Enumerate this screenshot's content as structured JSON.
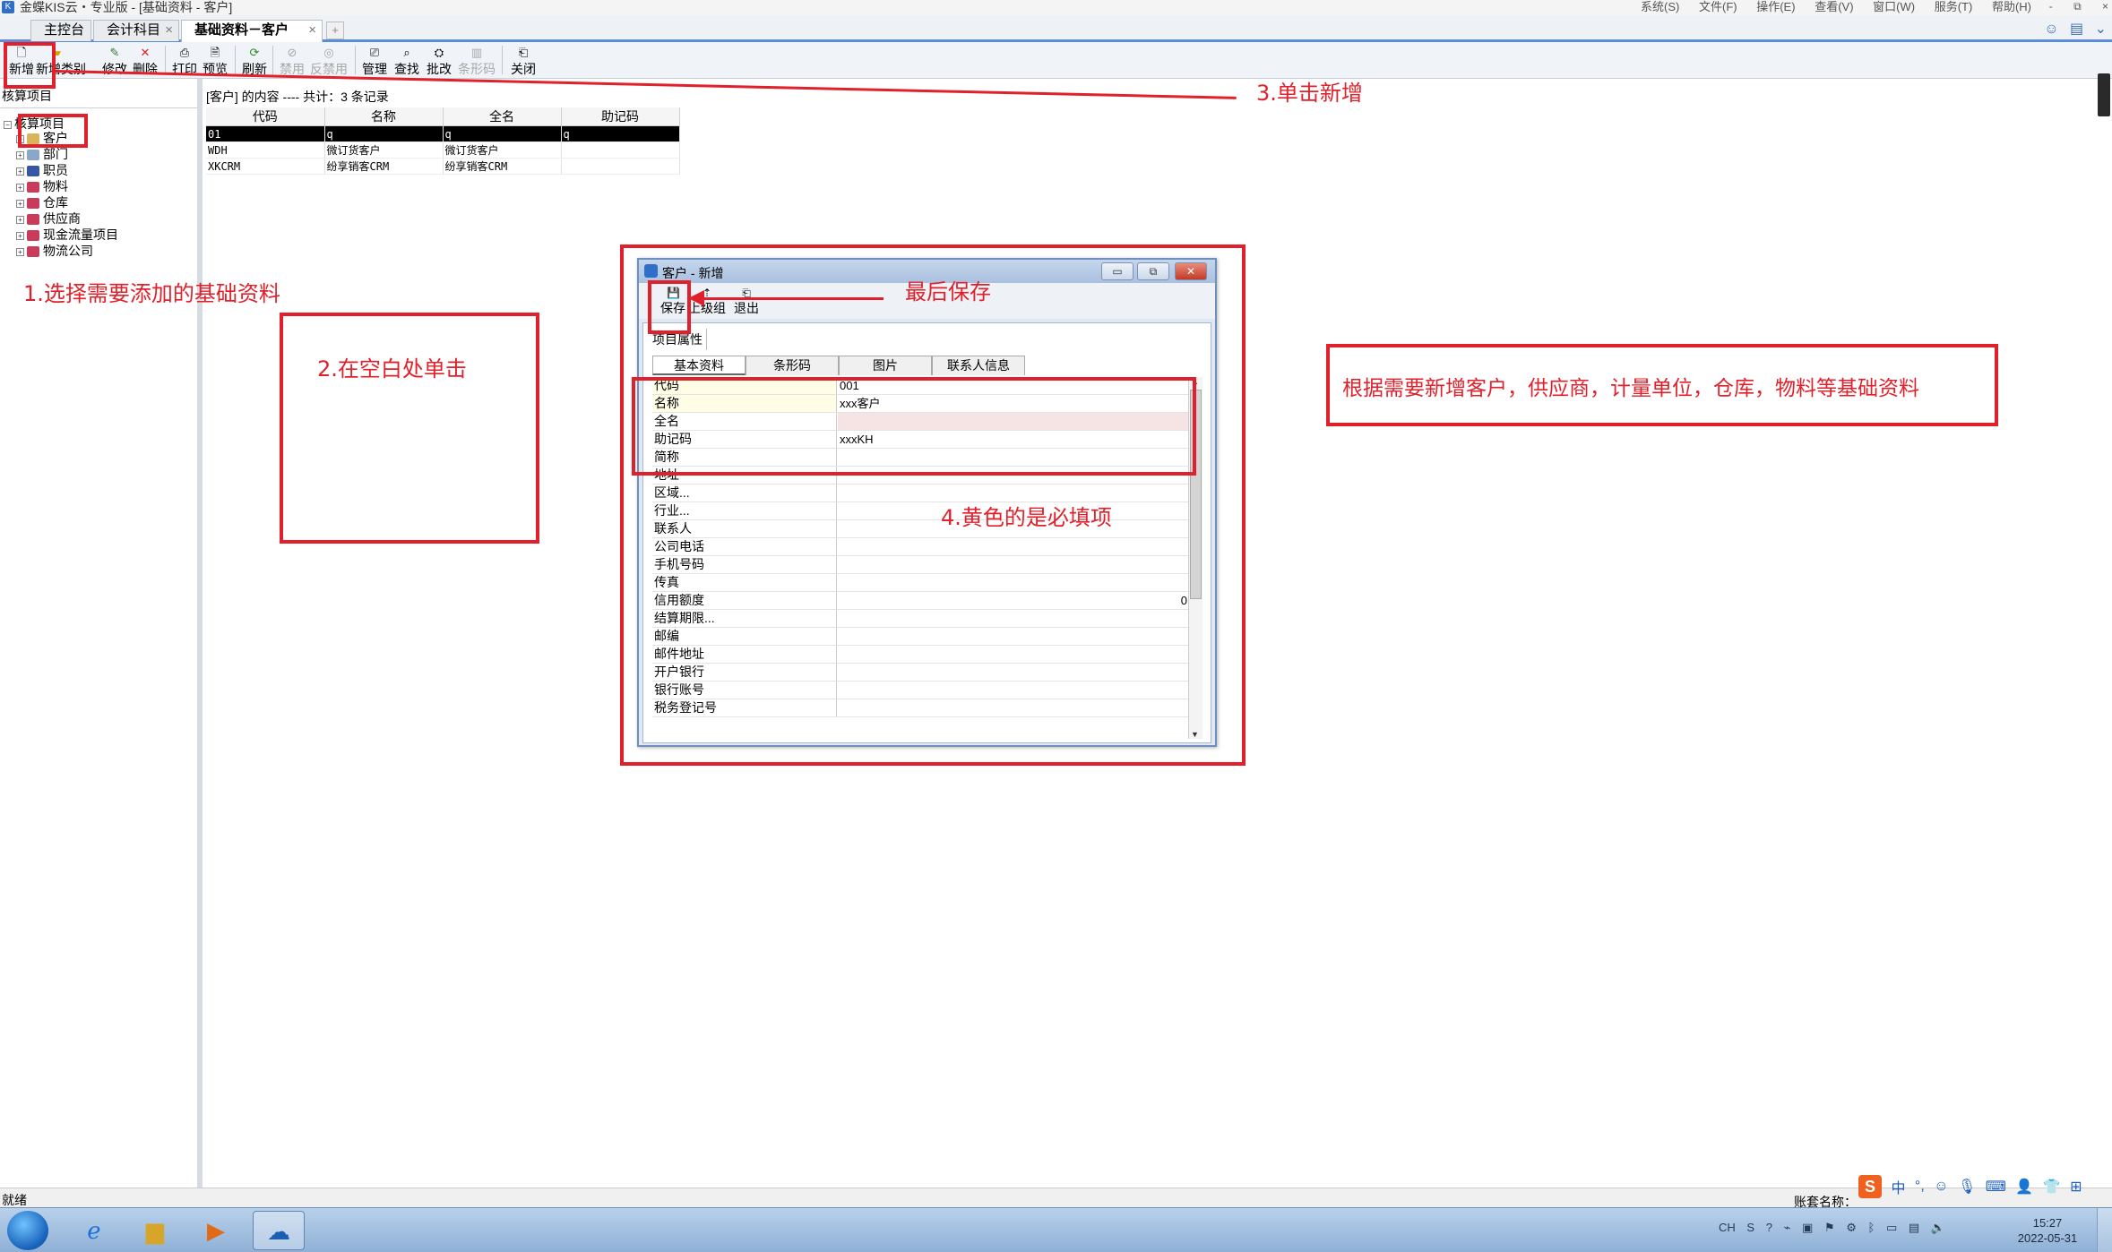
{
  "window": {
    "title": "金蝶KIS云・专业版 - [基础资料 - 客户]",
    "menus": [
      "系统(S)",
      "文件(F)",
      "操作(E)",
      "查看(V)",
      "窗口(W)",
      "服务(T)",
      "帮助(H)"
    ],
    "controls": [
      "-",
      "⧉",
      "×"
    ]
  },
  "tabs": [
    {
      "label": "主控台",
      "closable": false
    },
    {
      "label": "会计科目",
      "closable": true
    },
    {
      "label": "基础资料－客户",
      "closable": true,
      "active": true
    }
  ],
  "tab_close": "×",
  "tab_add": "+",
  "toolbar": {
    "new": "新增",
    "new_category": "新增类别",
    "edit": "修改",
    "delete": "删除",
    "print": "打印",
    "preview": "预览",
    "refresh": "刷新",
    "disable": "禁用",
    "enable": "反禁用",
    "manage": "管理",
    "find": "查找",
    "batch_edit": "批改",
    "barcode": "条形码",
    "close": "关闭"
  },
  "tree": {
    "header": "核算项目",
    "root": "核算项目",
    "items": [
      "客户",
      "部门",
      "职员",
      "物料",
      "仓库",
      "供应商",
      "现金流量项目",
      "物流公司"
    ]
  },
  "list": {
    "header": "[客户] 的内容 ---- 共计：3 条记录",
    "columns": [
      "代码",
      "名称",
      "全名",
      "助记码"
    ],
    "rows": [
      [
        "01",
        "q",
        "q",
        "q"
      ],
      [
        "WDH",
        "微订货客户",
        "微订货客户",
        ""
      ],
      [
        "XKCRM",
        "纷享销客CRM",
        "纷享销客CRM",
        ""
      ]
    ]
  },
  "dialog": {
    "title": "客户 - 新增",
    "buttons": {
      "save": "保存",
      "parent_group": "上级组",
      "exit": "退出"
    },
    "window_buttons": [
      "▭",
      "⧉",
      "✕"
    ],
    "properties_tab": "项目属性",
    "subtabs": [
      "基本资料",
      "条形码",
      "图片",
      "联系人信息"
    ],
    "fields": [
      {
        "label": "代码",
        "value": "001",
        "required": true
      },
      {
        "label": "名称",
        "value": "xxx客户",
        "required": true
      },
      {
        "label": "全名",
        "value": ""
      },
      {
        "label": "助记码",
        "value": "xxxKH"
      },
      {
        "label": "简称",
        "value": ""
      },
      {
        "label": "地址",
        "value": ""
      },
      {
        "label": "区域...",
        "value": ""
      },
      {
        "label": "行业...",
        "value": ""
      },
      {
        "label": "联系人",
        "value": ""
      },
      {
        "label": "公司电话",
        "value": ""
      },
      {
        "label": "手机号码",
        "value": ""
      },
      {
        "label": "传真",
        "value": ""
      },
      {
        "label": "信用额度",
        "value": "0"
      },
      {
        "label": "结算期限...",
        "value": ""
      },
      {
        "label": "邮编",
        "value": ""
      },
      {
        "label": "邮件地址",
        "value": ""
      },
      {
        "label": "开户银行",
        "value": ""
      },
      {
        "label": "银行账号",
        "value": ""
      },
      {
        "label": "税务登记号",
        "value": ""
      }
    ]
  },
  "annotations": {
    "step1": "1.选择需要添加的基础资料",
    "step2": "2.在空白处单击",
    "step3": "3.单击新增",
    "step4": "4.黄色的是必填项",
    "save_last": "最后保存",
    "note": "根据需要新增客户，供应商，计量单位，仓库，物料等基础资料",
    "color": "#e0202a"
  },
  "status": {
    "left": "就绪",
    "account": "账套名称："
  },
  "ime": {
    "logo": "S",
    "mode": "中"
  },
  "taskbar": {
    "lang": "CH",
    "time": "15:27",
    "date": "2022-05-31"
  }
}
